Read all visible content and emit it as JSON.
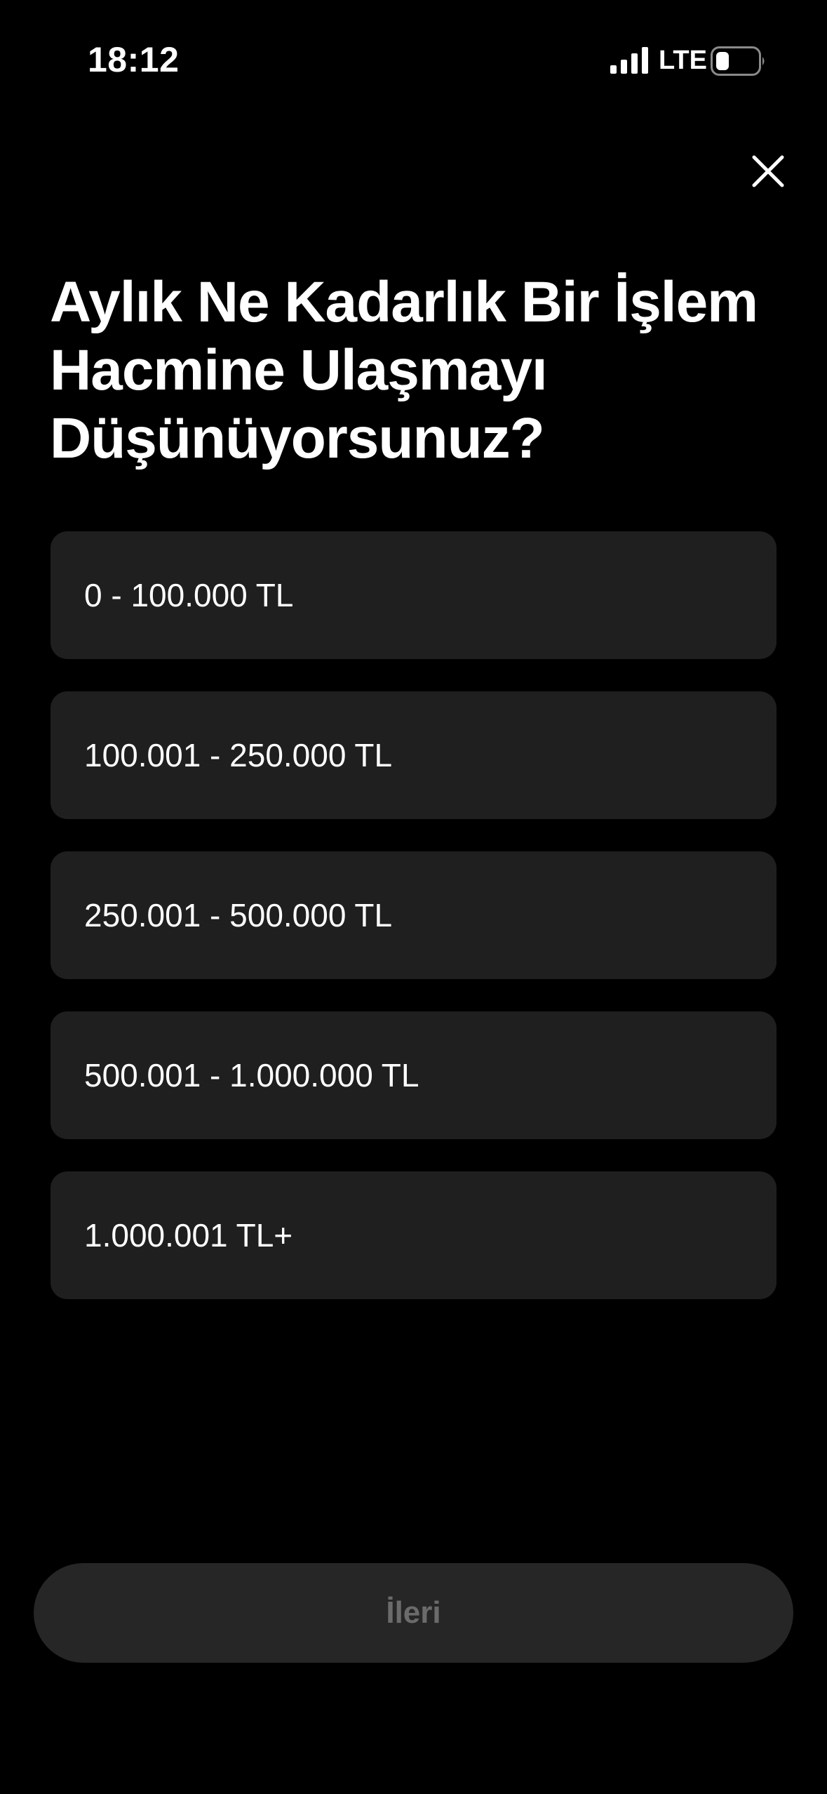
{
  "status_bar": {
    "time": "18:12",
    "network": "LTE",
    "icons": [
      "signal-icon",
      "battery-icon"
    ]
  },
  "header": {
    "close_icon": "close-icon"
  },
  "question": {
    "title_lines": [
      "Aylık Ne Kadarlık Bir İşlem",
      "Hacmine Ulaşmayı",
      "Düşünüyorsunuz?"
    ]
  },
  "options": [
    {
      "label": "0 - 100.000 TL"
    },
    {
      "label": "100.001 - 250.000 TL"
    },
    {
      "label": "250.001 - 500.000 TL"
    },
    {
      "label": "500.001 - 1.000.000 TL"
    },
    {
      "label": "1.000.001 TL+"
    }
  ],
  "footer": {
    "next_label": "İleri"
  },
  "colors": {
    "background": "#000000",
    "option_background": "#1f1f1f",
    "button_background": "#262626",
    "button_text_disabled": "#6b6b6b",
    "text": "#ffffff"
  }
}
